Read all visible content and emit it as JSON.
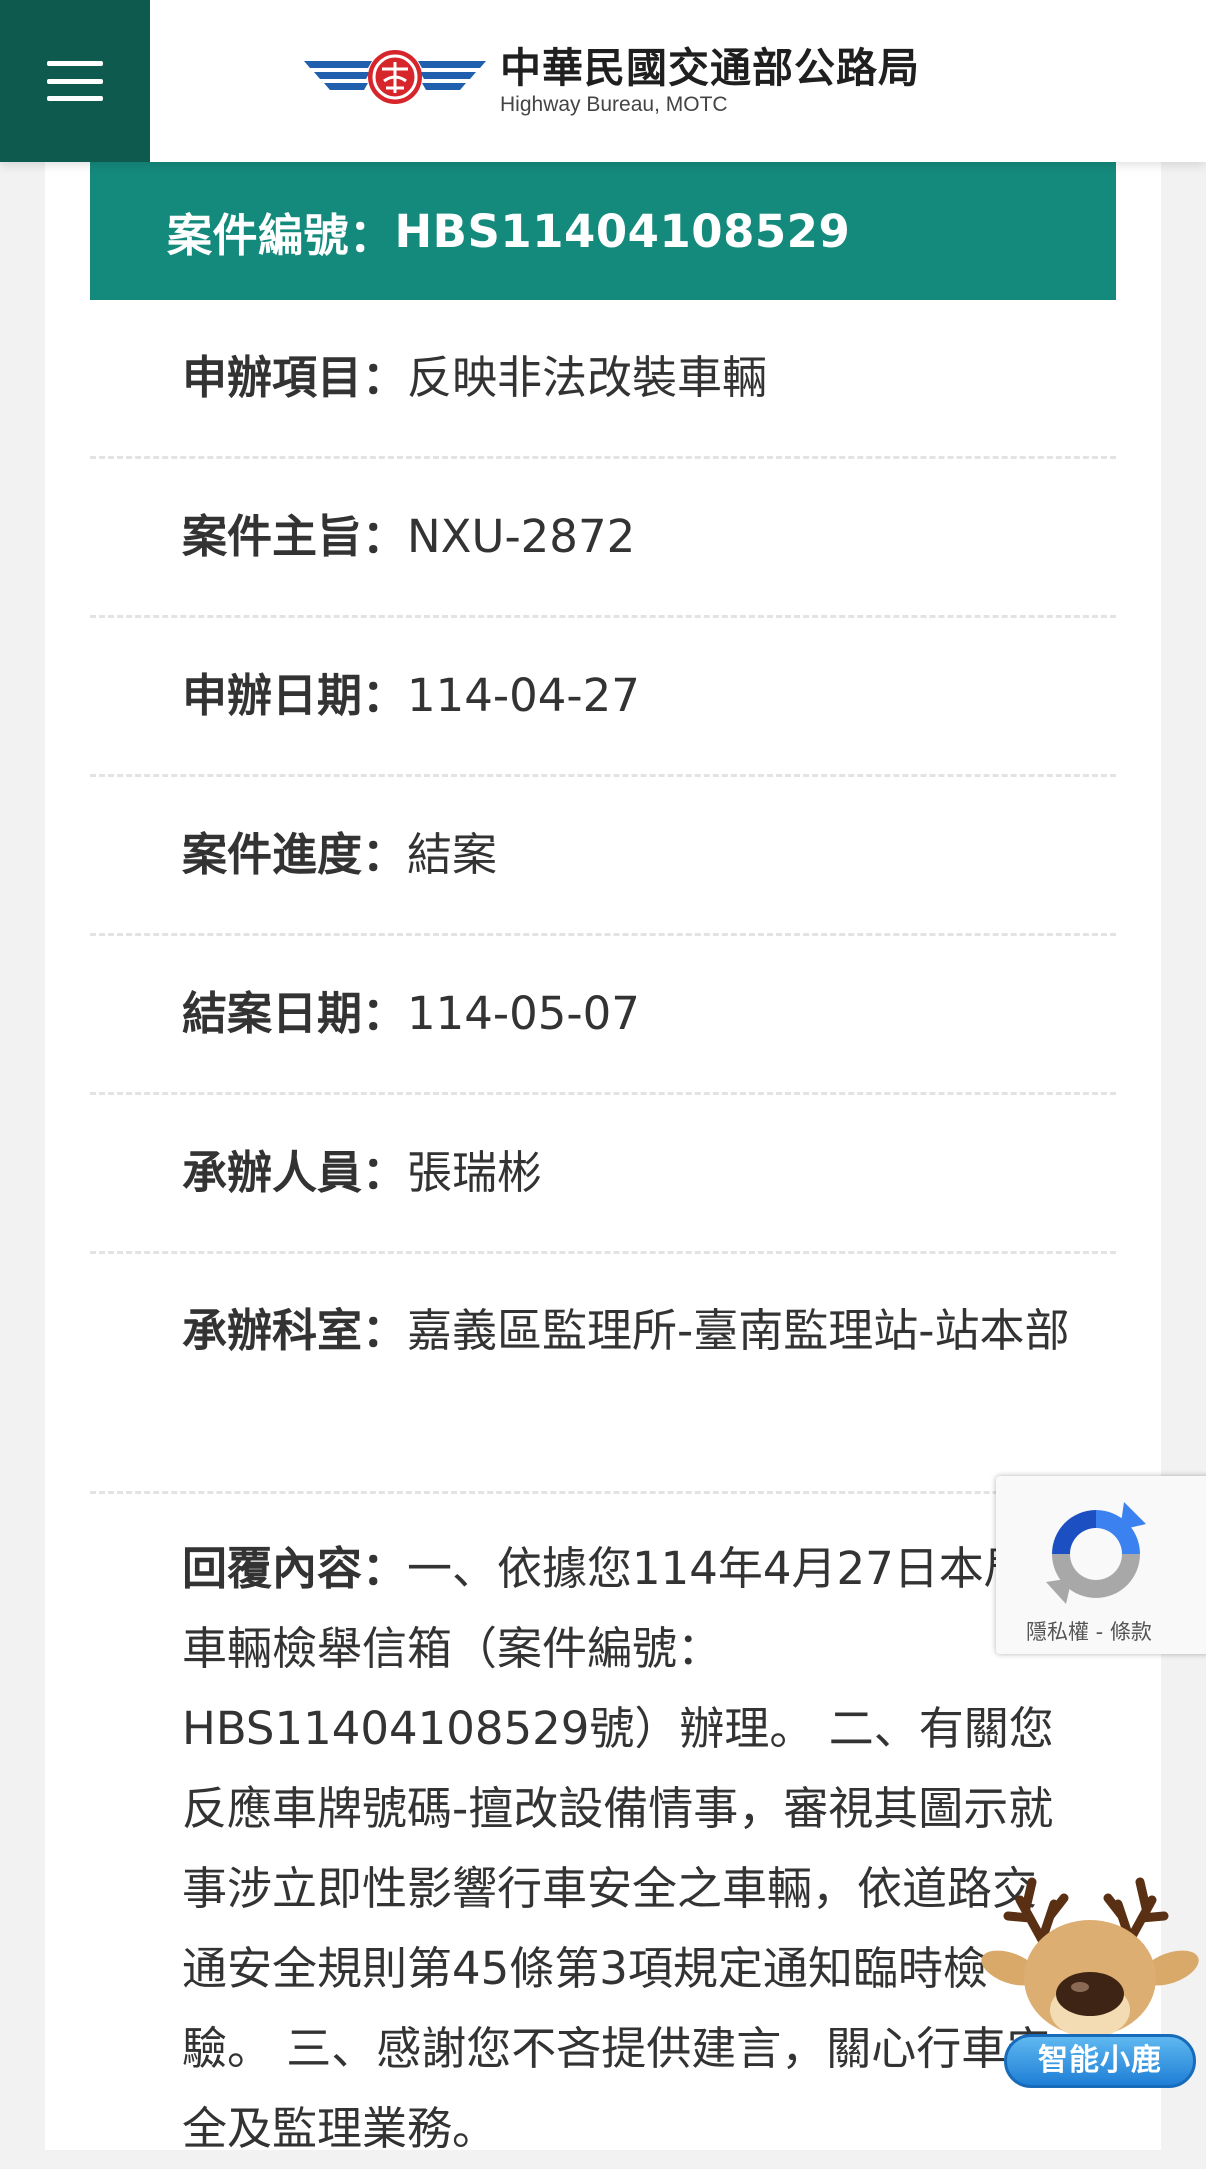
{
  "header": {
    "logo_zh": "中華民國交通部公路局",
    "logo_en": "Highway Bureau, MOTC"
  },
  "case": {
    "title_label": "案件編號：",
    "case_number": "HBS11404108529",
    "fields": [
      {
        "label": "申辦項目：",
        "value": "反映非法改裝車輛"
      },
      {
        "label": "案件主旨：",
        "value": "NXU-2872"
      },
      {
        "label": "申辦日期：",
        "value": "114-04-27"
      },
      {
        "label": "案件進度：",
        "value": "結案"
      },
      {
        "label": "結案日期：",
        "value": "114-05-07"
      },
      {
        "label": "承辦人員：",
        "value": "張瑞彬"
      },
      {
        "label": "承辦科室：",
        "value": "嘉義區監理所-臺南監理站-站本部"
      }
    ],
    "reply_label": "回覆內容：",
    "reply_text": "一、依據您114年4月27日本局車輛檢舉信箱（案件編號：HBS11404108529號）辦理。 二、有關您反應車牌號碼-擅改設備情事，審視其圖示就事涉立即性影響行車安全之車輛，依道路交通安全規則第45條第3項規定通知臨時檢驗。 三、感謝您不吝提供建言，關心行車安全及監理業務。"
  },
  "recaptcha": {
    "links": "隱私權 - 條款"
  },
  "assistant": {
    "label": "智能小鹿"
  },
  "colors": {
    "brand_dark": "#0f5a4f",
    "header_teal": "#148a7c"
  },
  "icons": {
    "menu": "hamburger-icon",
    "logo": "highway-bureau-wing-emblem",
    "recaptcha": "recaptcha-icon",
    "assistant": "deer-mascot-icon"
  }
}
